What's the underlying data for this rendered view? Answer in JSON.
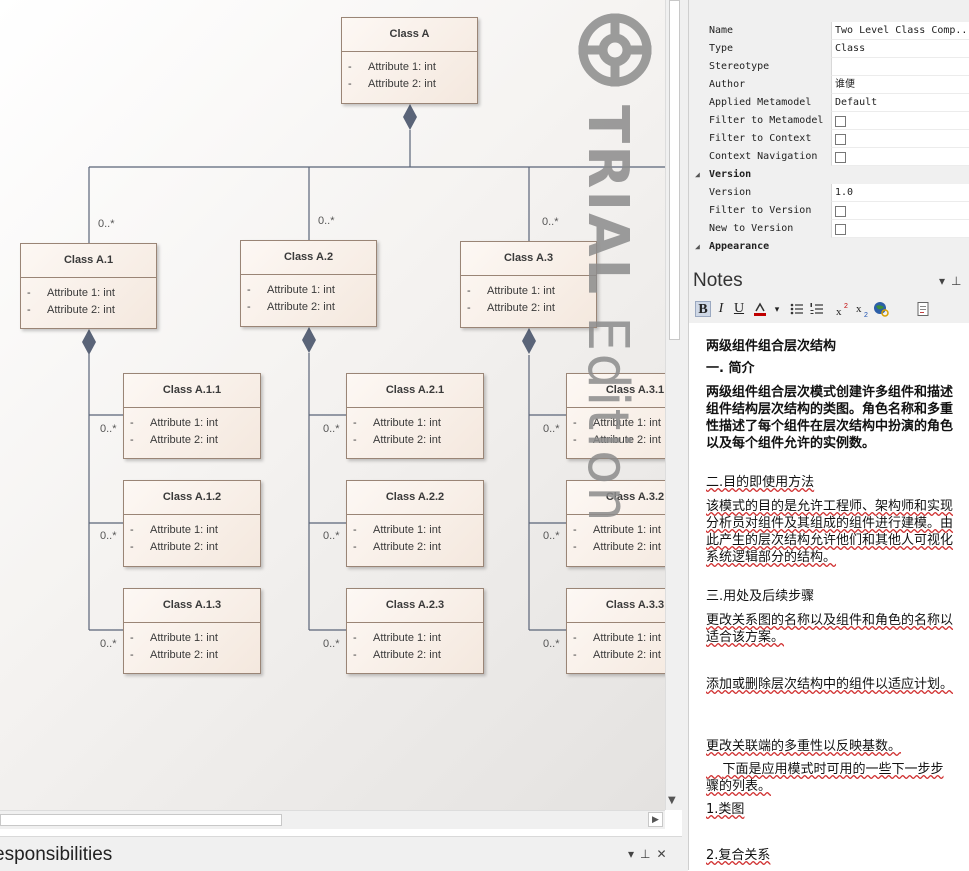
{
  "diagram": {
    "classes": [
      {
        "id": "A",
        "name": "Class A",
        "attrs": [
          "Attribute 1: int",
          "Attribute 2: int"
        ]
      },
      {
        "id": "A1",
        "name": "Class A.1",
        "attrs": [
          "Attribute 1: int",
          "Attribute 2: int"
        ]
      },
      {
        "id": "A2",
        "name": "Class A.2",
        "attrs": [
          "Attribute 1: int",
          "Attribute 2: int"
        ]
      },
      {
        "id": "A3",
        "name": "Class A.3",
        "attrs": [
          "Attribute 1: int",
          "Attribute 2: int"
        ]
      },
      {
        "id": "A11",
        "name": "Class A.1.1",
        "attrs": [
          "Attribute 1: int",
          "Attribute 2: int"
        ]
      },
      {
        "id": "A12",
        "name": "Class A.1.2",
        "attrs": [
          "Attribute 1: int",
          "Attribute 2: int"
        ]
      },
      {
        "id": "A13",
        "name": "Class A.1.3",
        "attrs": [
          "Attribute 1: int",
          "Attribute 2: int"
        ]
      },
      {
        "id": "A21",
        "name": "Class A.2.1",
        "attrs": [
          "Attribute 1: int",
          "Attribute 2: int"
        ]
      },
      {
        "id": "A22",
        "name": "Class A.2.2",
        "attrs": [
          "Attribute 1: int",
          "Attribute 2: int"
        ]
      },
      {
        "id": "A23",
        "name": "Class A.2.3",
        "attrs": [
          "Attribute 1: int",
          "Attribute 2: int"
        ]
      },
      {
        "id": "A31",
        "name": "Class A.3.1",
        "attrs": [
          "Attribute 1: int",
          "Attribute 2: int"
        ]
      },
      {
        "id": "A32",
        "name": "Class A.3.2",
        "attrs": [
          "Attribute 1: int",
          "Attribute 2: int"
        ]
      },
      {
        "id": "A33",
        "name": "Class A.3.3",
        "attrs": [
          "Attribute 1: int",
          "Attribute 2: int"
        ]
      }
    ],
    "visibility": "-",
    "multiplicity": "0..*",
    "watermark_bold": "TRIAL",
    "watermark_light": " Edition"
  },
  "bottom_panel": {
    "title": "esponsibilities"
  },
  "properties": {
    "rows": [
      {
        "key": "Name",
        "value": "Two Level Class Comp..."
      },
      {
        "key": "Type",
        "value": "Class"
      },
      {
        "key": "Stereotype",
        "value": ""
      },
      {
        "key": "Author",
        "value": "谁便"
      },
      {
        "key": "Applied Metamodel",
        "value": "Default"
      },
      {
        "key": "Filter to Metamodel",
        "value": "checkbox"
      },
      {
        "key": "Filter to Context",
        "value": "checkbox"
      },
      {
        "key": "Context Navigation",
        "value": "checkbox"
      },
      {
        "key": "Version",
        "section": true
      },
      {
        "key": "Version",
        "value": "1.0"
      },
      {
        "key": "Filter to Version",
        "value": "checkbox"
      },
      {
        "key": "New to Version",
        "value": "checkbox"
      },
      {
        "key": "Appearance",
        "section": true
      }
    ]
  },
  "notes": {
    "title": "Notes",
    "toolbar": [
      "B",
      "I",
      "U"
    ],
    "paragraphs": [
      {
        "text": "两级组件组合层次结构",
        "bold": true
      },
      {
        "text": "一. 简介",
        "bold": true
      },
      {
        "text": "两级组件组合层次模式创建许多组件和描述组件结构层次结构的类图。角色名称和多重性描述了每个组件在层次结构中扮演的角色以及每个组件允许的实例数。",
        "bold": true
      },
      {
        "text": "二.目的即使用方法",
        "bold": false
      },
      {
        "text": "该模式的目的是允许工程师、架构师和实现分析员对组件及其组成的组件进行建模。由此产生的层次结构允许他们和其他人可视化系统逻辑部分的结构。",
        "bold": false
      },
      {
        "text": "三.用处及后续步骤",
        "bold": false
      },
      {
        "text": "更改关系图的名称以及组件和角色的名称以适合该方案。",
        "bold": false
      },
      {
        "text": "添加或删除层次结构中的组件以适应计划。",
        "bold": false
      },
      {
        "text": "更改关联端的多重性以反映基数。",
        "bold": false
      },
      {
        "text": "    下面是应用模式时可用的一些下一步步骤的列表。",
        "bold": false
      },
      {
        "text": "1.类图",
        "bold": false
      },
      {
        "text": "2.复合关系",
        "bold": false
      }
    ]
  },
  "colors": {
    "class_fill": "#f4e8de",
    "class_border": "#9a8576",
    "connector": "#5a6478",
    "spellcheck": "#d03030"
  }
}
